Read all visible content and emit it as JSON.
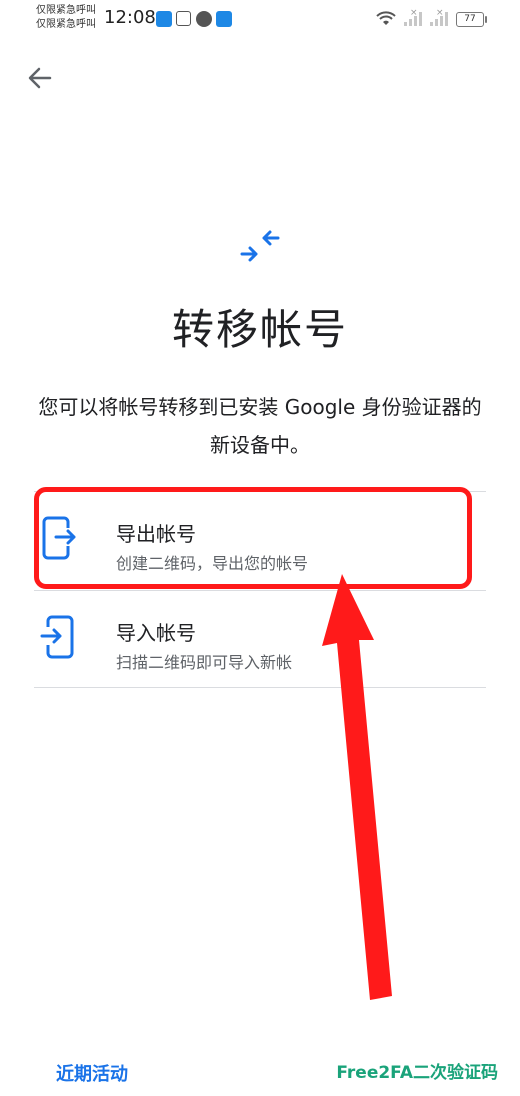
{
  "status_bar": {
    "carrier_line1": "仅限紧急呼叫",
    "carrier_line2": "仅限紧急呼叫",
    "time": "12:08",
    "battery": "77"
  },
  "header": {
    "back_icon": "arrow-left-icon"
  },
  "hero": {
    "icon": "transfer-arrows-icon",
    "title": "转移帐号",
    "description": "您可以将帐号转移到已安装 Google 身份验证器的新设备中。"
  },
  "options": [
    {
      "icon": "export-phone-icon",
      "label": "导出帐号",
      "sub": "创建二维码，导出您的帐号"
    },
    {
      "icon": "import-phone-icon",
      "label": "导入帐号",
      "sub": "扫描二维码即可导入新帐"
    }
  ],
  "footer": {
    "recent_label": "近期活动",
    "watermark": "Free2FA二次验证码"
  },
  "colors": {
    "accent": "#1a73e8",
    "annotation": "#ff1a1a",
    "watermark": "#1aa37a"
  }
}
